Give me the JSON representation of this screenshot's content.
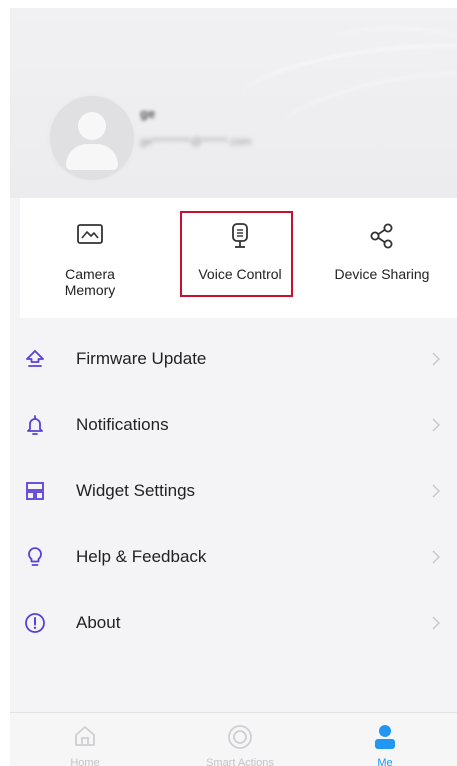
{
  "profile": {
    "name": "ge",
    "email": "ge*********@******.com"
  },
  "quick_actions": [
    {
      "label": "Camera\nMemory",
      "icon": "camera-memory-icon"
    },
    {
      "label": "Voice Control",
      "icon": "voice-control-icon"
    },
    {
      "label": "Device Sharing",
      "icon": "share-icon"
    }
  ],
  "menu": [
    {
      "label": "Firmware Update",
      "icon": "firmware-update-icon"
    },
    {
      "label": "Notifications",
      "icon": "bell-icon"
    },
    {
      "label": "Widget Settings",
      "icon": "widget-icon"
    },
    {
      "label": "Help & Feedback",
      "icon": "lightbulb-icon"
    },
    {
      "label": "About",
      "icon": "info-icon"
    }
  ],
  "bottom_nav": [
    {
      "label": "Home",
      "icon": "home-icon"
    },
    {
      "label": "Smart Actions",
      "icon": "smart-actions-icon"
    },
    {
      "label": "Me",
      "icon": "person-icon"
    }
  ],
  "colors": {
    "accent": "#5b3fd9",
    "active_tab": "#2196f3",
    "highlight_box": "#c8102e"
  }
}
